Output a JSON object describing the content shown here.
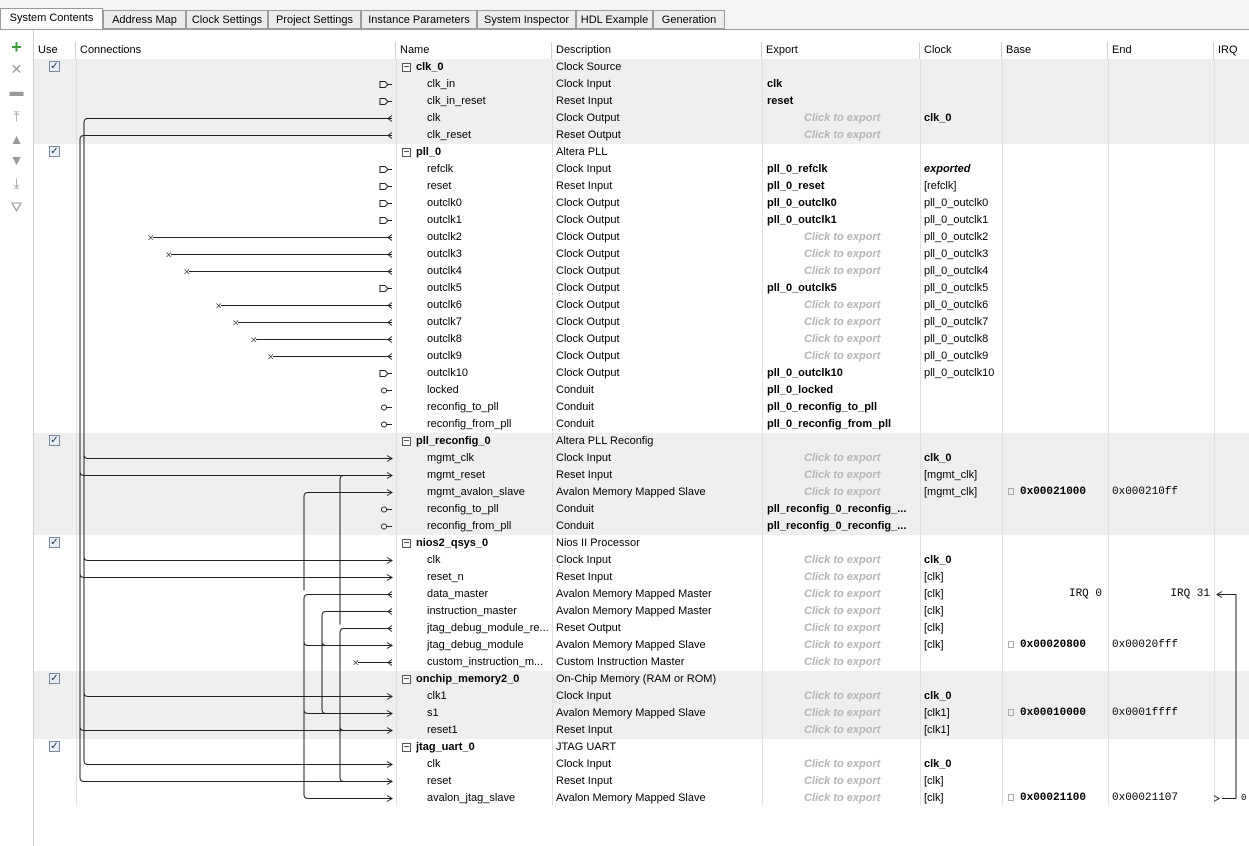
{
  "tabs": [
    "System Contents",
    "Address Map",
    "Clock Settings",
    "Project Settings",
    "Instance Parameters",
    "System Inspector",
    "HDL Example",
    "Generation"
  ],
  "toolbar_icons": [
    "add-icon",
    "remove-icon",
    "edit-icon",
    "move-top-icon",
    "move-up-icon",
    "move-down-icon",
    "move-bottom-icon",
    "filter-icon"
  ],
  "headers": {
    "use": "Use",
    "connections": "Connections",
    "name": "Name",
    "description": "Description",
    "export": "Export",
    "clock": "Clock",
    "base": "Base",
    "end": "End",
    "irq": "IRQ"
  },
  "rows": [
    {
      "name": "clk_0",
      "desc": "Clock Source",
      "export": "",
      "clock": "",
      "base": "",
      "end": "",
      "irq": "",
      "kind": "component"
    },
    {
      "name": "clk_in",
      "desc": "Clock Input",
      "export": "clk",
      "clock": "",
      "base": "",
      "end": "",
      "irq": "",
      "kind": "sub"
    },
    {
      "name": "clk_in_reset",
      "desc": "Reset Input",
      "export": "reset",
      "clock": "",
      "base": "",
      "end": "",
      "irq": "",
      "kind": "sub"
    },
    {
      "name": "clk",
      "desc": "Clock Output",
      "export": "Click to export",
      "clock": "clk_0",
      "base": "",
      "end": "",
      "irq": "",
      "kind": "sub"
    },
    {
      "name": "clk_reset",
      "desc": "Reset Output",
      "export": "Click to export",
      "clock": "",
      "base": "",
      "end": "",
      "irq": "",
      "kind": "sub"
    },
    {
      "name": "pll_0",
      "desc": "Altera PLL",
      "export": "",
      "clock": "",
      "base": "",
      "end": "",
      "irq": "",
      "kind": "component"
    },
    {
      "name": "refclk",
      "desc": "Clock Input",
      "export": "pll_0_refclk",
      "clock": "exported",
      "base": "",
      "end": "",
      "irq": "",
      "kind": "sub"
    },
    {
      "name": "reset",
      "desc": "Reset Input",
      "export": "pll_0_reset",
      "clock": "[refclk]",
      "base": "",
      "end": "",
      "irq": "",
      "kind": "sub"
    },
    {
      "name": "outclk0",
      "desc": "Clock Output",
      "export": "pll_0_outclk0",
      "clock": "pll_0_outclk0",
      "base": "",
      "end": "",
      "irq": "",
      "kind": "sub"
    },
    {
      "name": "outclk1",
      "desc": "Clock Output",
      "export": "pll_0_outclk1",
      "clock": "pll_0_outclk1",
      "base": "",
      "end": "",
      "irq": "",
      "kind": "sub"
    },
    {
      "name": "outclk2",
      "desc": "Clock Output",
      "export": "Click to export",
      "clock": "pll_0_outclk2",
      "base": "",
      "end": "",
      "irq": "",
      "kind": "sub"
    },
    {
      "name": "outclk3",
      "desc": "Clock Output",
      "export": "Click to export",
      "clock": "pll_0_outclk3",
      "base": "",
      "end": "",
      "irq": "",
      "kind": "sub"
    },
    {
      "name": "outclk4",
      "desc": "Clock Output",
      "export": "Click to export",
      "clock": "pll_0_outclk4",
      "base": "",
      "end": "",
      "irq": "",
      "kind": "sub"
    },
    {
      "name": "outclk5",
      "desc": "Clock Output",
      "export": "pll_0_outclk5",
      "clock": "pll_0_outclk5",
      "base": "",
      "end": "",
      "irq": "",
      "kind": "sub"
    },
    {
      "name": "outclk6",
      "desc": "Clock Output",
      "export": "Click to export",
      "clock": "pll_0_outclk6",
      "base": "",
      "end": "",
      "irq": "",
      "kind": "sub"
    },
    {
      "name": "outclk7",
      "desc": "Clock Output",
      "export": "Click to export",
      "clock": "pll_0_outclk7",
      "base": "",
      "end": "",
      "irq": "",
      "kind": "sub"
    },
    {
      "name": "outclk8",
      "desc": "Clock Output",
      "export": "Click to export",
      "clock": "pll_0_outclk8",
      "base": "",
      "end": "",
      "irq": "",
      "kind": "sub"
    },
    {
      "name": "outclk9",
      "desc": "Clock Output",
      "export": "Click to export",
      "clock": "pll_0_outclk9",
      "base": "",
      "end": "",
      "irq": "",
      "kind": "sub"
    },
    {
      "name": "outclk10",
      "desc": "Clock Output",
      "export": "pll_0_outclk10",
      "clock": "pll_0_outclk10",
      "base": "",
      "end": "",
      "irq": "",
      "kind": "sub"
    },
    {
      "name": "locked",
      "desc": "Conduit",
      "export": "pll_0_locked",
      "clock": "",
      "base": "",
      "end": "",
      "irq": "",
      "kind": "sub"
    },
    {
      "name": "reconfig_to_pll",
      "desc": "Conduit",
      "export": "pll_0_reconfig_to_pll",
      "clock": "",
      "base": "",
      "end": "",
      "irq": "",
      "kind": "sub"
    },
    {
      "name": "reconfig_from_pll",
      "desc": "Conduit",
      "export": "pll_0_reconfig_from_pll",
      "clock": "",
      "base": "",
      "end": "",
      "irq": "",
      "kind": "sub"
    },
    {
      "name": "pll_reconfig_0",
      "desc": "Altera PLL Reconfig",
      "export": "",
      "clock": "",
      "base": "",
      "end": "",
      "irq": "",
      "kind": "component"
    },
    {
      "name": "mgmt_clk",
      "desc": "Clock Input",
      "export": "Click to export",
      "clock": "clk_0",
      "base": "",
      "end": "",
      "irq": "",
      "kind": "sub"
    },
    {
      "name": "mgmt_reset",
      "desc": "Reset Input",
      "export": "Click to export",
      "clock": "[mgmt_clk]",
      "base": "",
      "end": "",
      "irq": "",
      "kind": "sub"
    },
    {
      "name": "mgmt_avalon_slave",
      "desc": "Avalon Memory Mapped Slave",
      "export": "Click to export",
      "clock": "[mgmt_clk]",
      "base": "0x00021000",
      "end": "0x000210ff",
      "irq": "",
      "kind": "sub"
    },
    {
      "name": "reconfig_to_pll",
      "desc": "Conduit",
      "export": "pll_reconfig_0_reconfig_...",
      "clock": "",
      "base": "",
      "end": "",
      "irq": "",
      "kind": "sub"
    },
    {
      "name": "reconfig_from_pll",
      "desc": "Conduit",
      "export": "pll_reconfig_0_reconfig_...",
      "clock": "",
      "base": "",
      "end": "",
      "irq": "",
      "kind": "sub"
    },
    {
      "name": "nios2_qsys_0",
      "desc": "Nios II Processor",
      "export": "",
      "clock": "",
      "base": "",
      "end": "",
      "irq": "",
      "kind": "component"
    },
    {
      "name": "clk",
      "desc": "Clock Input",
      "export": "Click to export",
      "clock": "clk_0",
      "base": "",
      "end": "",
      "irq": "",
      "kind": "sub"
    },
    {
      "name": "reset_n",
      "desc": "Reset Input",
      "export": "Click to export",
      "clock": "[clk]",
      "base": "",
      "end": "",
      "irq": "",
      "kind": "sub"
    },
    {
      "name": "data_master",
      "desc": "Avalon Memory Mapped Master",
      "export": "Click to export",
      "clock": "[clk]",
      "base": "IRQ 0",
      "end": "IRQ 31",
      "irq": "",
      "kind": "sub"
    },
    {
      "name": "instruction_master",
      "desc": "Avalon Memory Mapped Master",
      "export": "Click to export",
      "clock": "[clk]",
      "base": "",
      "end": "",
      "irq": "",
      "kind": "sub"
    },
    {
      "name": "jtag_debug_module_re...",
      "desc": "Reset Output",
      "export": "Click to export",
      "clock": "[clk]",
      "base": "",
      "end": "",
      "irq": "",
      "kind": "sub"
    },
    {
      "name": "jtag_debug_module",
      "desc": "Avalon Memory Mapped Slave",
      "export": "Click to export",
      "clock": "[clk]",
      "base": "0x00020800",
      "end": "0x00020fff",
      "irq": "",
      "kind": "sub"
    },
    {
      "name": "custom_instruction_m...",
      "desc": "Custom Instruction Master",
      "export": "Click to export",
      "clock": "",
      "base": "",
      "end": "",
      "irq": "",
      "kind": "sub"
    },
    {
      "name": "onchip_memory2_0",
      "desc": "On-Chip Memory (RAM or ROM)",
      "export": "",
      "clock": "",
      "base": "",
      "end": "",
      "irq": "",
      "kind": "component"
    },
    {
      "name": "clk1",
      "desc": "Clock Input",
      "export": "Click to export",
      "clock": "clk_0",
      "base": "",
      "end": "",
      "irq": "",
      "kind": "sub"
    },
    {
      "name": "s1",
      "desc": "Avalon Memory Mapped Slave",
      "export": "Click to export",
      "clock": "[clk1]",
      "base": "0x00010000",
      "end": "0x0001ffff",
      "irq": "",
      "kind": "sub"
    },
    {
      "name": "reset1",
      "desc": "Reset Input",
      "export": "Click to export",
      "clock": "[clk1]",
      "base": "",
      "end": "",
      "irq": "",
      "kind": "sub"
    },
    {
      "name": "jtag_uart_0",
      "desc": "JTAG UART",
      "export": "",
      "clock": "",
      "base": "",
      "end": "",
      "irq": "",
      "kind": "component"
    },
    {
      "name": "clk",
      "desc": "Clock Input",
      "export": "Click to export",
      "clock": "clk_0",
      "base": "",
      "end": "",
      "irq": "",
      "kind": "sub"
    },
    {
      "name": "reset",
      "desc": "Reset Input",
      "export": "Click to export",
      "clock": "[clk]",
      "base": "",
      "end": "",
      "irq": "",
      "kind": "sub"
    },
    {
      "name": "avalon_jtag_slave",
      "desc": "Avalon Memory Mapped Slave",
      "export": "Click to export",
      "clock": "[clk]",
      "base": "0x00021100",
      "end": "0x00021107",
      "irq": "0",
      "kind": "sub"
    }
  ],
  "colors": {
    "shade": "#efefef",
    "click_to_export": "#b5b5b5",
    "add": "#3a9a3a"
  }
}
